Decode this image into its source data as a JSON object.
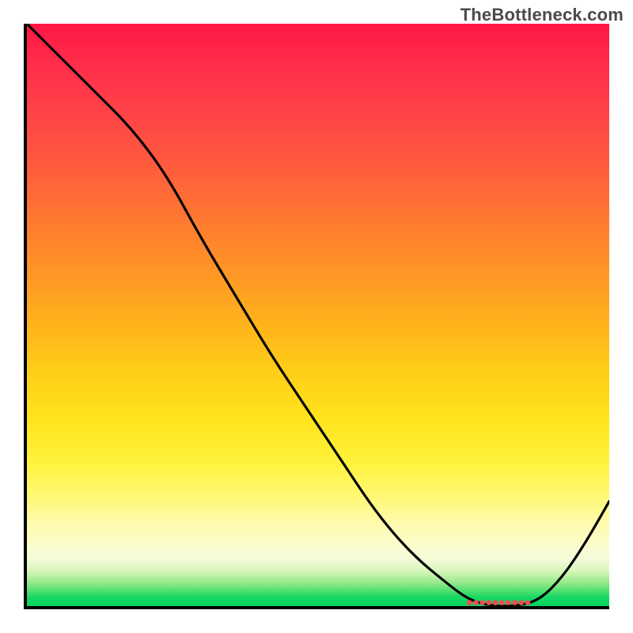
{
  "watermark": "TheBottleneck.com",
  "chart_data": {
    "type": "line",
    "title": "",
    "xlabel": "",
    "ylabel": "",
    "xlim": [
      0,
      100
    ],
    "ylim": [
      0,
      100
    ],
    "grid": false,
    "legend": false,
    "series": [
      {
        "name": "curve",
        "x": [
          0,
          6,
          12,
          18,
          24,
          30,
          36,
          42,
          48,
          54,
          60,
          66,
          72,
          76,
          80,
          84,
          88,
          92,
          96,
          100
        ],
        "y": [
          100,
          94,
          88,
          82,
          74,
          63,
          53,
          43,
          34,
          25,
          16,
          9,
          4,
          1,
          0,
          0,
          1,
          5,
          11,
          18
        ]
      }
    ],
    "markers": [
      {
        "name": "sweet-spot-dots",
        "style": "red-dotted",
        "x_range": [
          76,
          86
        ],
        "y": 0.6
      }
    ],
    "background_gradient": {
      "orientation": "vertical",
      "stops": [
        {
          "pos": 0.0,
          "color": "#ff1744"
        },
        {
          "pos": 0.24,
          "color": "#ff5a3e"
        },
        {
          "pos": 0.52,
          "color": "#ffb41b"
        },
        {
          "pos": 0.75,
          "color": "#fff23a"
        },
        {
          "pos": 0.9,
          "color": "#fbfcd0"
        },
        {
          "pos": 0.96,
          "color": "#95e98a"
        },
        {
          "pos": 1.0,
          "color": "#07d45f"
        }
      ]
    }
  }
}
